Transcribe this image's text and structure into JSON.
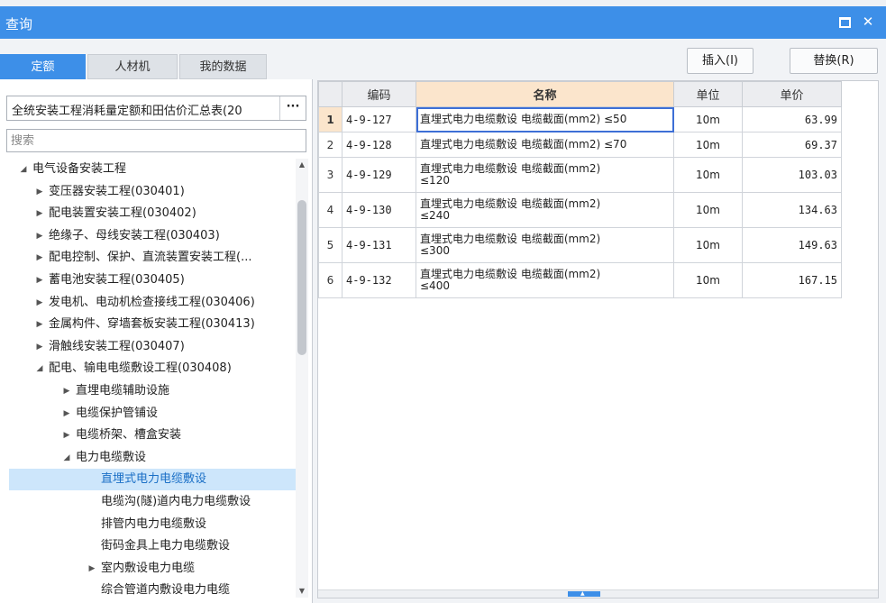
{
  "window": {
    "title": "查询",
    "max_icon": "maximize-icon",
    "close_glyph": "✕"
  },
  "tabs": [
    {
      "label": "定额",
      "active": true
    },
    {
      "label": "人材机",
      "active": false
    },
    {
      "label": "我的数据",
      "active": false
    }
  ],
  "actions": {
    "insert_label": "插入(I)",
    "replace_label": "替换(R)"
  },
  "source": {
    "value": "全统安装工程消耗量定额和田估价汇总表(20",
    "more_label": "···"
  },
  "search": {
    "placeholder": "搜索",
    "value": ""
  },
  "tree": [
    {
      "label": "电气设备安装工程",
      "level": 0,
      "expanded": true
    },
    {
      "label": "变压器安装工程(030401)",
      "level": 1,
      "expanded": false
    },
    {
      "label": "配电装置安装工程(030402)",
      "level": 1,
      "expanded": false
    },
    {
      "label": "绝缘子、母线安装工程(030403)",
      "level": 1,
      "expanded": false
    },
    {
      "label": "配电控制、保护、直流装置安装工程(...",
      "level": 1,
      "expanded": false
    },
    {
      "label": "蓄电池安装工程(030405)",
      "level": 1,
      "expanded": false
    },
    {
      "label": "发电机、电动机检查接线工程(030406)",
      "level": 1,
      "expanded": false
    },
    {
      "label": "金属构件、穿墙套板安装工程(030413)",
      "level": 1,
      "expanded": false
    },
    {
      "label": "滑触线安装工程(030407)",
      "level": 1,
      "expanded": false
    },
    {
      "label": "配电、输电电缆敷设工程(030408)",
      "level": 1,
      "expanded": true
    },
    {
      "label": "直埋电缆辅助设施",
      "level": 2,
      "expanded": false
    },
    {
      "label": "电缆保护管铺设",
      "level": 2,
      "expanded": false
    },
    {
      "label": "电缆桥架、槽盒安装",
      "level": 2,
      "expanded": false
    },
    {
      "label": "电力电缆敷设",
      "level": 2,
      "expanded": true
    },
    {
      "label": "直埋式电力电缆敷设",
      "level": 3,
      "leaf": true,
      "selected": true
    },
    {
      "label": "电缆沟(隧)道内电力电缆敷设",
      "level": 3,
      "leaf": true
    },
    {
      "label": "排管内电力电缆敷设",
      "level": 3,
      "leaf": true
    },
    {
      "label": "街码金具上电力电缆敷设",
      "level": 3,
      "leaf": true
    },
    {
      "label": "室内敷设电力电缆",
      "level": 3,
      "expanded": false
    },
    {
      "label": "综合管道内敷设电力电缆",
      "level": 3,
      "leaf": true
    }
  ],
  "grid": {
    "columns": [
      "",
      "编码",
      "名称",
      "单位",
      "单价"
    ],
    "rows": [
      {
        "no": "1",
        "code": "4-9-127",
        "name1": "直埋式电力电缆敷设 电缆截面(mm2) ≤50",
        "name2": "",
        "unit": "10m",
        "price": "63.99"
      },
      {
        "no": "2",
        "code": "4-9-128",
        "name1": "直埋式电力电缆敷设 电缆截面(mm2) ≤70",
        "name2": "",
        "unit": "10m",
        "price": "69.37"
      },
      {
        "no": "3",
        "code": "4-9-129",
        "name1": "直埋式电力电缆敷设 电缆截面(mm2)",
        "name2": "≤120",
        "unit": "10m",
        "price": "103.03"
      },
      {
        "no": "4",
        "code": "4-9-130",
        "name1": "直埋式电力电缆敷设 电缆截面(mm2)",
        "name2": "≤240",
        "unit": "10m",
        "price": "134.63"
      },
      {
        "no": "5",
        "code": "4-9-131",
        "name1": "直埋式电力电缆敷设 电缆截面(mm2)",
        "name2": "≤300",
        "unit": "10m",
        "price": "149.63"
      },
      {
        "no": "6",
        "code": "4-9-132",
        "name1": "直埋式电力电缆敷设 电缆截面(mm2)",
        "name2": "≤400",
        "unit": "10m",
        "price": "167.15"
      }
    ]
  },
  "colors": {
    "accent": "#3d8fe8",
    "header_highlight": "#fbe5cc",
    "selection": "#cde6fb"
  }
}
